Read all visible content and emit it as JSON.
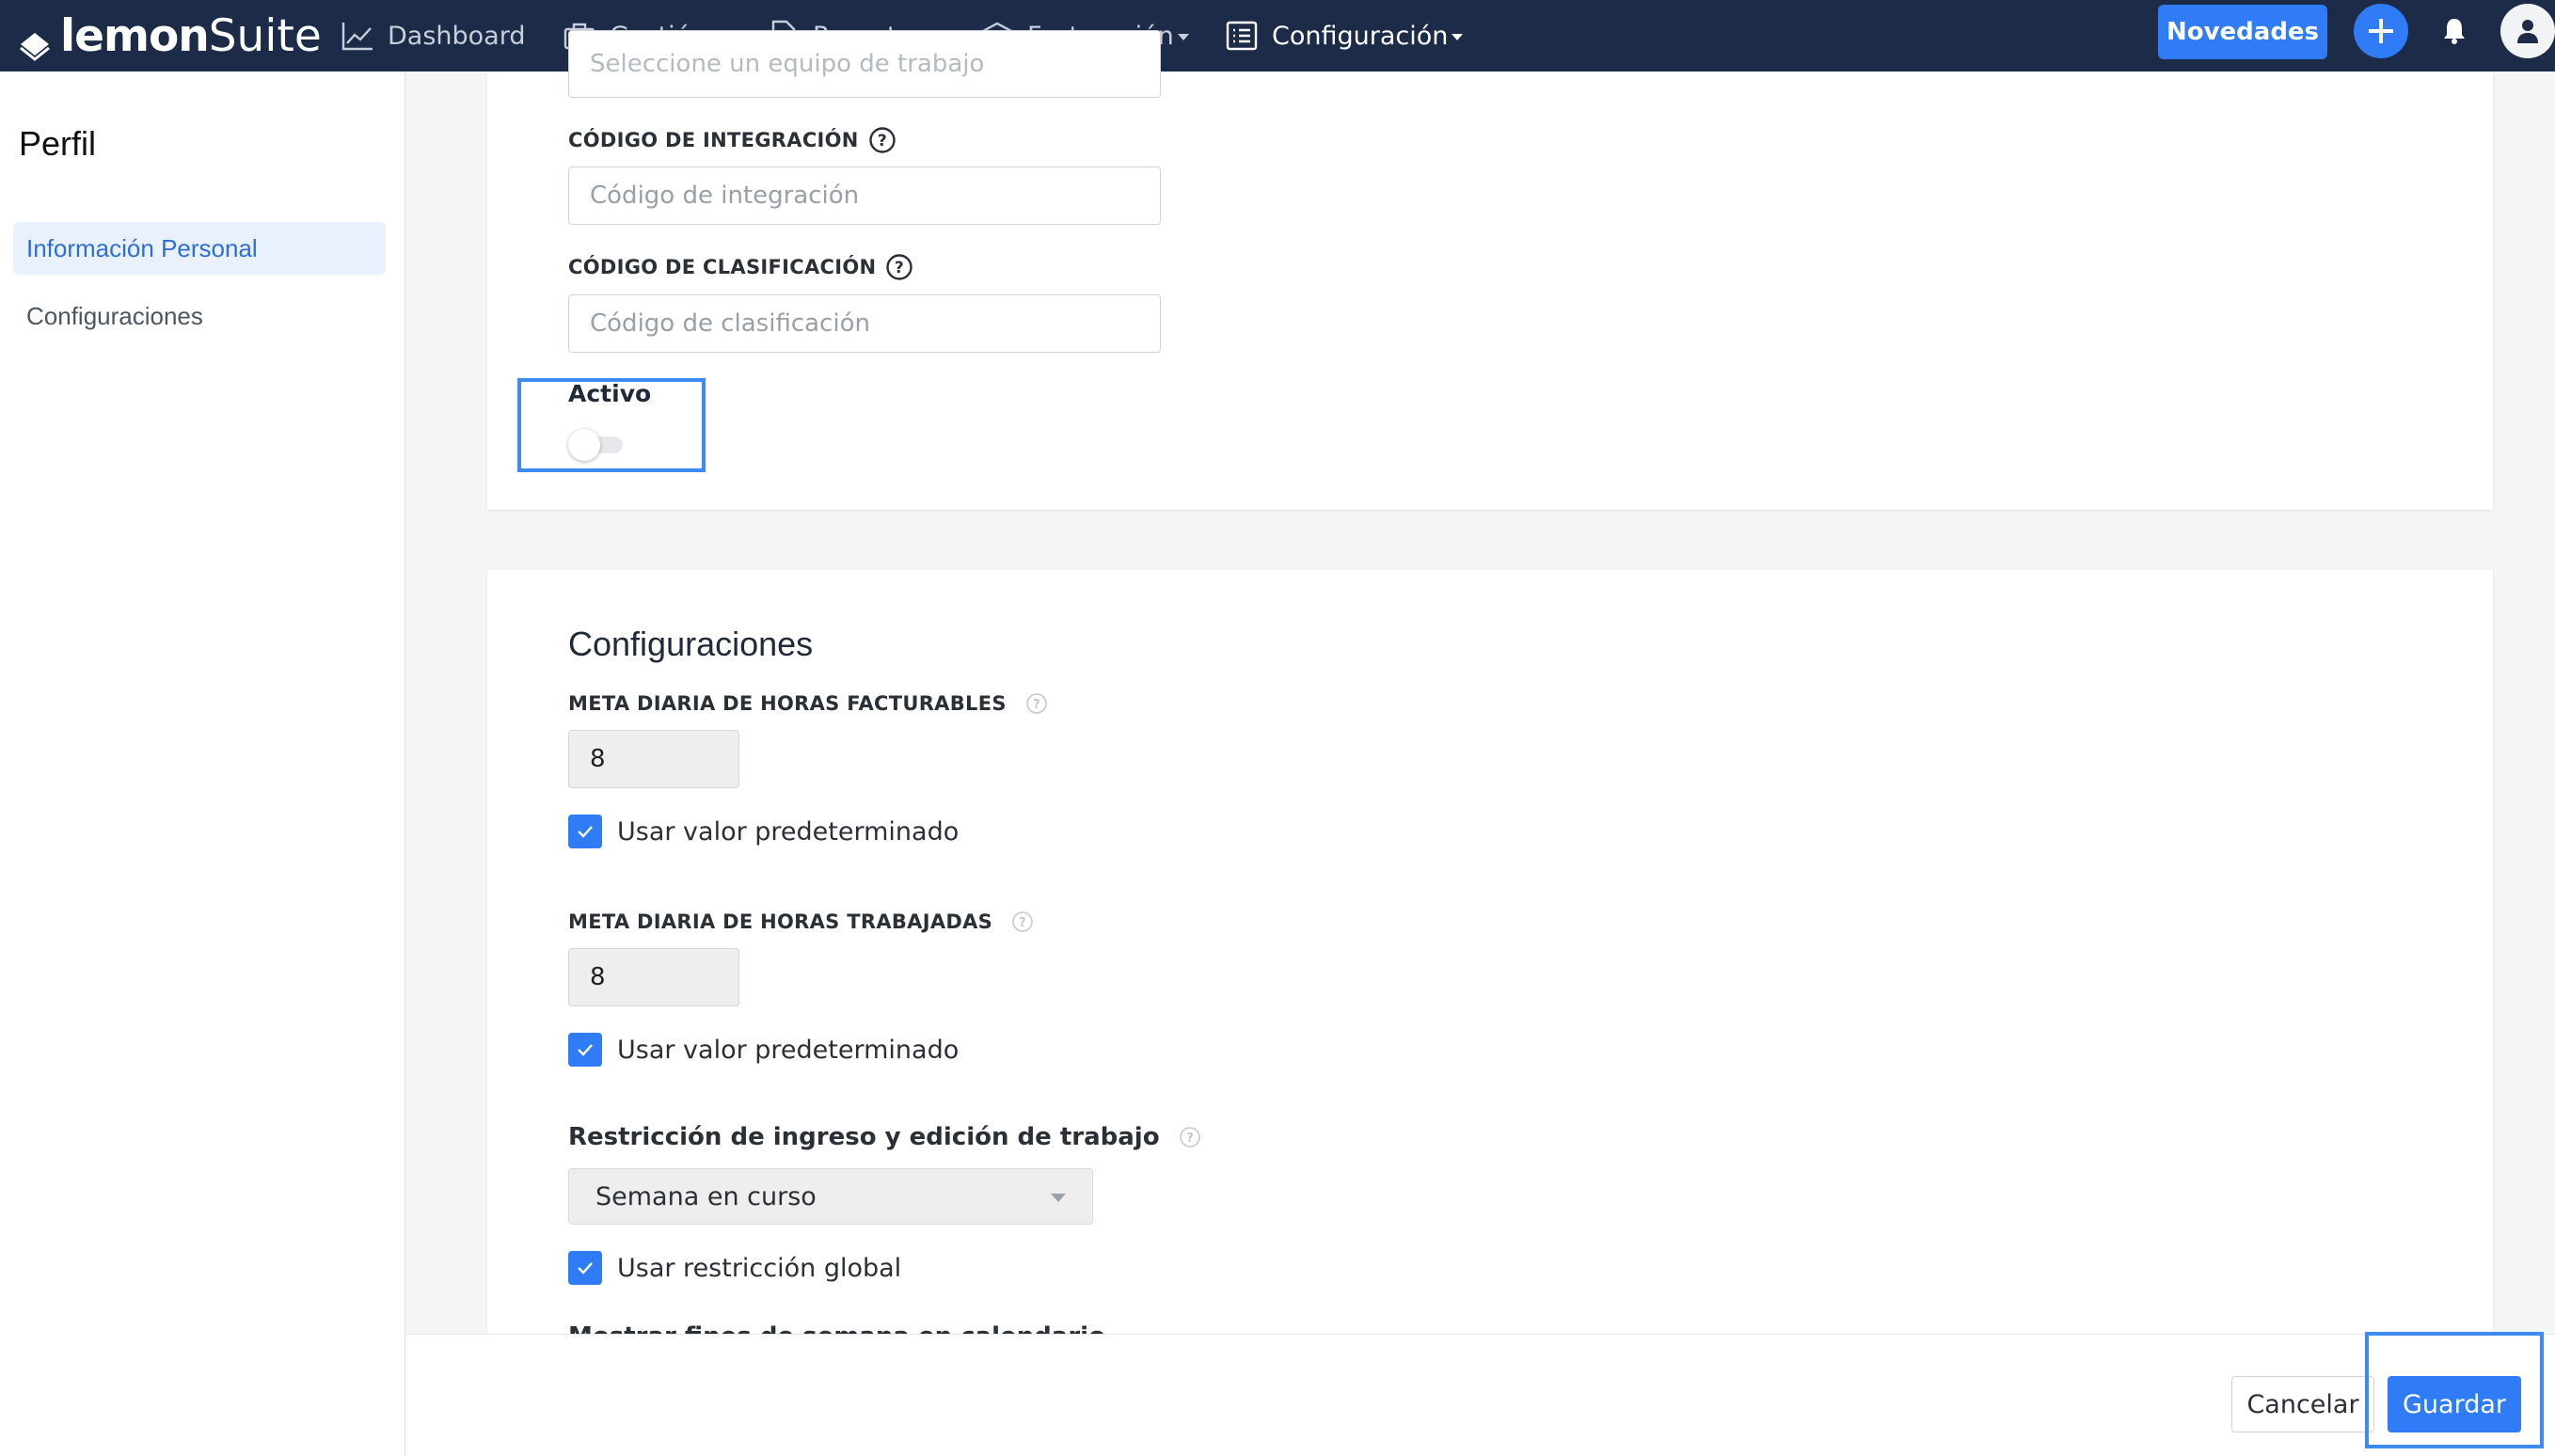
{
  "brand": {
    "name_bold": "lemon",
    "name_light": "Suite"
  },
  "nav": {
    "items": [
      {
        "label": "Dashboard",
        "icon": "chart-line-icon"
      },
      {
        "label": "Gestión",
        "icon": "briefcase-icon"
      },
      {
        "label": "Reportes",
        "icon": "report-icon"
      },
      {
        "label": "Facturación",
        "icon": "billing-icon"
      },
      {
        "label": "Configuración",
        "icon": "list-icon"
      }
    ],
    "novedades": "Novedades"
  },
  "sidebar": {
    "title": "Perfil",
    "items": [
      {
        "label": "Información Personal"
      },
      {
        "label": "Configuraciones"
      }
    ]
  },
  "profile_card": {
    "team_placeholder": "Seleccione un equipo de trabajo",
    "integration_label": "CÓDIGO DE INTEGRACIÓN",
    "integration_placeholder": "Código de integración",
    "classification_label": "CÓDIGO DE CLASIFICACIÓN",
    "classification_placeholder": "Código de clasificación",
    "active_label": "Activo",
    "active_on": false
  },
  "config_card": {
    "title": "Configuraciones",
    "billable_label": "META DIARIA DE HORAS FACTURABLES",
    "billable_value": "8",
    "billable_default_label": "Usar valor predeterminado",
    "worked_label": "META DIARIA DE HORAS TRABAJADAS",
    "worked_value": "8",
    "worked_default_label": "Usar valor predeterminado",
    "restriction_label": "Restricción de ingreso y edición de trabajo",
    "restriction_value": "Semana en curso",
    "global_restriction_label": "Usar restricción global",
    "weekends_label": "Mostrar fines de semana en calendario"
  },
  "footer": {
    "cancel": "Cancelar",
    "save": "Guardar"
  },
  "colors": {
    "navbar": "#1b2b48",
    "primary": "#2f7cf6",
    "highlight": "#3d8bf0"
  }
}
